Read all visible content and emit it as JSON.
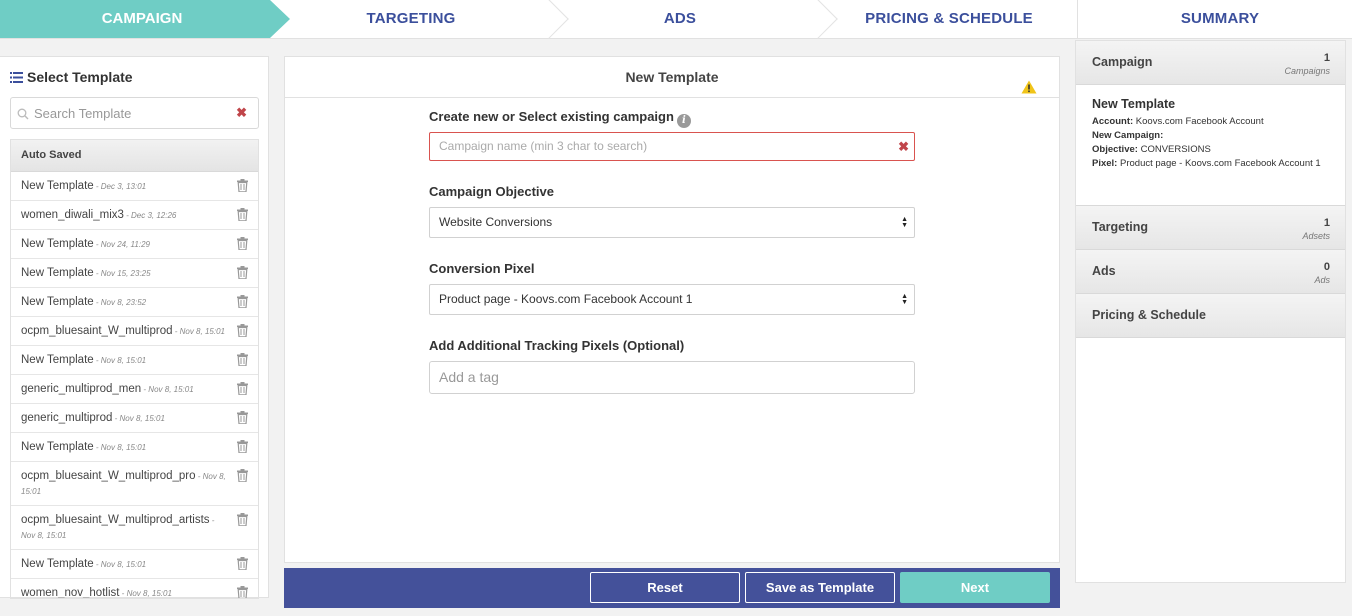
{
  "steps": {
    "campaign": "CAMPAIGN",
    "targeting": "TARGETING",
    "ads": "ADS",
    "pricing": "PRICING & SCHEDULE",
    "summary": "SUMMARY"
  },
  "left": {
    "title": "Select Template",
    "search_placeholder": "Search Template",
    "group": "Auto Saved",
    "items": [
      {
        "name": "New Template",
        "date": " - Dec 3, 13:01"
      },
      {
        "name": "women_diwali_mix3",
        "date": " - Dec 3, 12:26"
      },
      {
        "name": "New Template",
        "date": " - Nov 24, 11:29"
      },
      {
        "name": "New Template",
        "date": " - Nov 15, 23:25"
      },
      {
        "name": "New Template",
        "date": " - Nov 8, 23:52"
      },
      {
        "name": "ocpm_bluesaint_W_multiprod",
        "date": " - Nov 8, 15:01"
      },
      {
        "name": "New Template",
        "date": " - Nov 8, 15:01"
      },
      {
        "name": "generic_multiprod_men",
        "date": " - Nov 8, 15:01"
      },
      {
        "name": "generic_multiprod",
        "date": " - Nov 8, 15:01"
      },
      {
        "name": "New Template",
        "date": " - Nov 8, 15:01"
      },
      {
        "name": "ocpm_bluesaint_W_multiprod_pro",
        "date": " - Nov 8, 15:01"
      },
      {
        "name": "ocpm_bluesaint_W_multiprod_artists",
        "date": " - Nov 8, 15:01"
      },
      {
        "name": "New Template",
        "date": " - Nov 8, 15:01"
      },
      {
        "name": "women_nov_hotlist",
        "date": " - Nov 8, 15:01"
      }
    ]
  },
  "center": {
    "title": "New Template",
    "campaign_label": "Create new or Select existing campaign",
    "campaign_placeholder": "Campaign name (min 3 char to search)",
    "objective_label": "Campaign Objective",
    "objective_value": "Website Conversions",
    "pixel_label": "Conversion Pixel",
    "pixel_value": "Product page - Koovs.com Facebook Account 1",
    "tracking_label": "Add Additional Tracking Pixels (Optional)",
    "tracking_placeholder": "Add a tag"
  },
  "buttons": {
    "reset": "Reset",
    "save": "Save as Template",
    "next": "Next"
  },
  "summary": {
    "campaign": {
      "title": "Campaign",
      "count": "1",
      "unit": "Campaigns"
    },
    "detail": {
      "name": "New Template",
      "account_k": "Account:",
      "account_v": " Koovs.com Facebook Account",
      "newcamp_k": "New Campaign:",
      "newcamp_v": "",
      "objective_k": "Objective:",
      "objective_v": " CONVERSIONS",
      "pixel_k": "Pixel:",
      "pixel_v": " Product page - Koovs.com Facebook Account 1"
    },
    "targeting": {
      "title": "Targeting",
      "count": "1",
      "unit": "Adsets"
    },
    "ads": {
      "title": "Ads",
      "count": "0",
      "unit": "Ads"
    },
    "pricing": {
      "title": "Pricing & Schedule"
    }
  },
  "colors": {
    "accent": "#6fcdc5",
    "brand": "#44519a",
    "step_text": "#3b4f9c",
    "error": "#d9534f"
  }
}
